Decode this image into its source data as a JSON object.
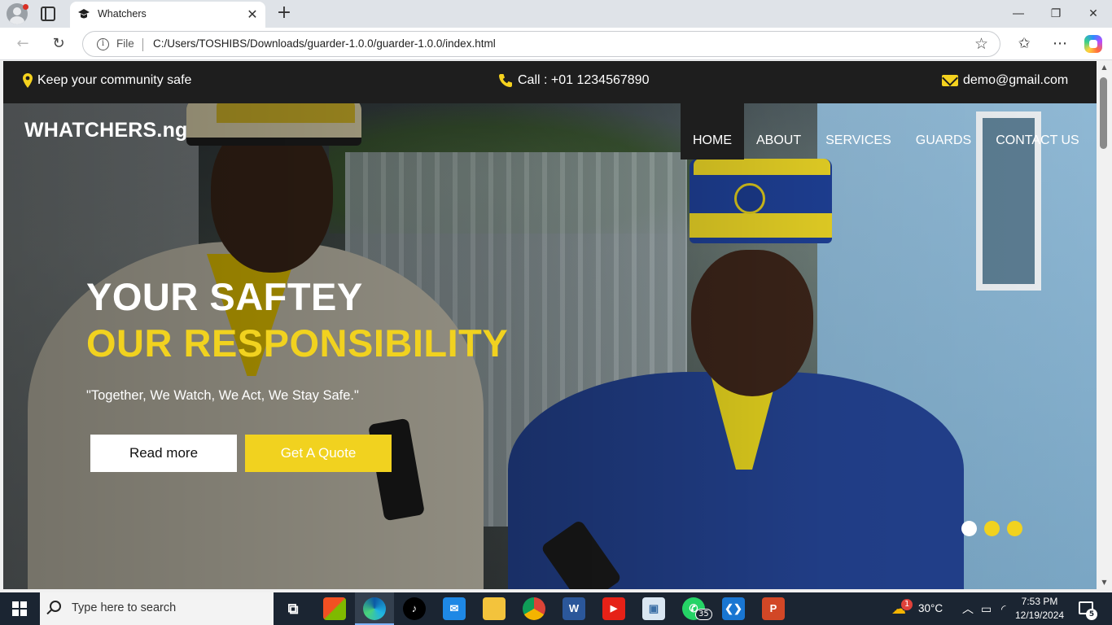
{
  "browser": {
    "tab_title": "Whatchers",
    "address_scheme_label": "File",
    "url": "C:/Users/TOSHIBS/Downloads/guarder-1.0.0/guarder-1.0.0/index.html",
    "new_tab_symbol": "+",
    "close_tab_symbol": "✕"
  },
  "topbar": {
    "location_text": "Keep your community safe",
    "phone_text": "Call : +01 1234567890",
    "email_text": "demo@gmail.com"
  },
  "site": {
    "brand": "WHATCHERS.ng",
    "nav": [
      {
        "label": "HOME",
        "active": true
      },
      {
        "label": "ABOUT",
        "active": false
      },
      {
        "label": "SERVICES",
        "active": false
      },
      {
        "label": "GUARDS",
        "active": false
      },
      {
        "label": "CONTACT US",
        "active": false
      }
    ],
    "hero": {
      "headline_line1": "YOUR SAFTEY",
      "headline_line2": "OUR RESPONSIBILITY",
      "tagline": "\"Together, We Watch, We Act, We Stay Safe.\"",
      "primary_button": "Read more",
      "secondary_button": "Get A Quote",
      "slides_total": 3,
      "active_slide": 1
    },
    "colors": {
      "accent": "#f1d21f",
      "dark": "#1e1e1e"
    }
  },
  "taskbar": {
    "search_placeholder": "Type here to search",
    "whatsapp_badge": "35",
    "weather_temp": "30°C",
    "weather_badge": "1",
    "time": "7:53 PM",
    "date": "12/19/2024",
    "notification_count": "5"
  }
}
